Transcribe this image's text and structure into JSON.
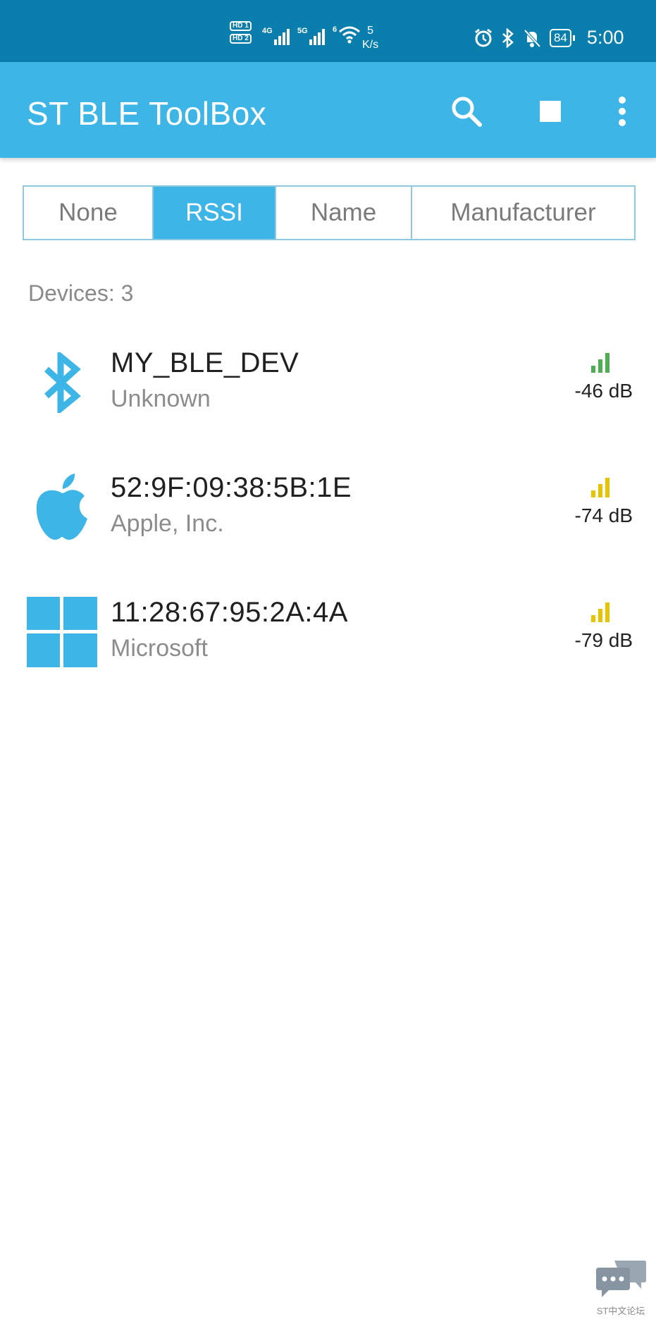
{
  "status_bar": {
    "sim_labels": [
      "HD 1",
      "HD 2"
    ],
    "net1": "4G",
    "net2": "5G",
    "wifi_label": "6",
    "speed_value": "5",
    "speed_unit": "K/s",
    "battery": "84",
    "time": "5:00"
  },
  "app_bar": {
    "title": "ST BLE ToolBox",
    "icons": [
      "search-icon",
      "stop-icon",
      "more-vert-icon"
    ]
  },
  "sort_tabs": {
    "options": [
      "None",
      "RSSI",
      "Name",
      "Manufacturer"
    ],
    "selected": "RSSI"
  },
  "device_count_label": "Devices: 3",
  "devices": [
    {
      "name": "MY_BLE_DEV",
      "manufacturer": "Unknown",
      "icon": "bluetooth-icon",
      "rssi": "-46 dB",
      "signal_bars": 3,
      "signal_color": "#4caf50"
    },
    {
      "name": "52:9F:09:38:5B:1E",
      "manufacturer": "Apple, Inc.",
      "icon": "apple-logo-icon",
      "rssi": "-74 dB",
      "signal_bars": 3,
      "signal_color": "#e6c500"
    },
    {
      "name": "11:28:67:95:2A:4A",
      "manufacturer": "Microsoft",
      "icon": "windows-logo-icon",
      "rssi": "-79 dB",
      "signal_bars": 3,
      "signal_color": "#e6c500"
    }
  ],
  "watermark": {
    "text": "ST中文论坛"
  },
  "colors": {
    "status_bar": "#0a7fae",
    "app_bar": "#3db5e6",
    "accent": "#3db5e6",
    "tab_border": "#8fc9df"
  }
}
